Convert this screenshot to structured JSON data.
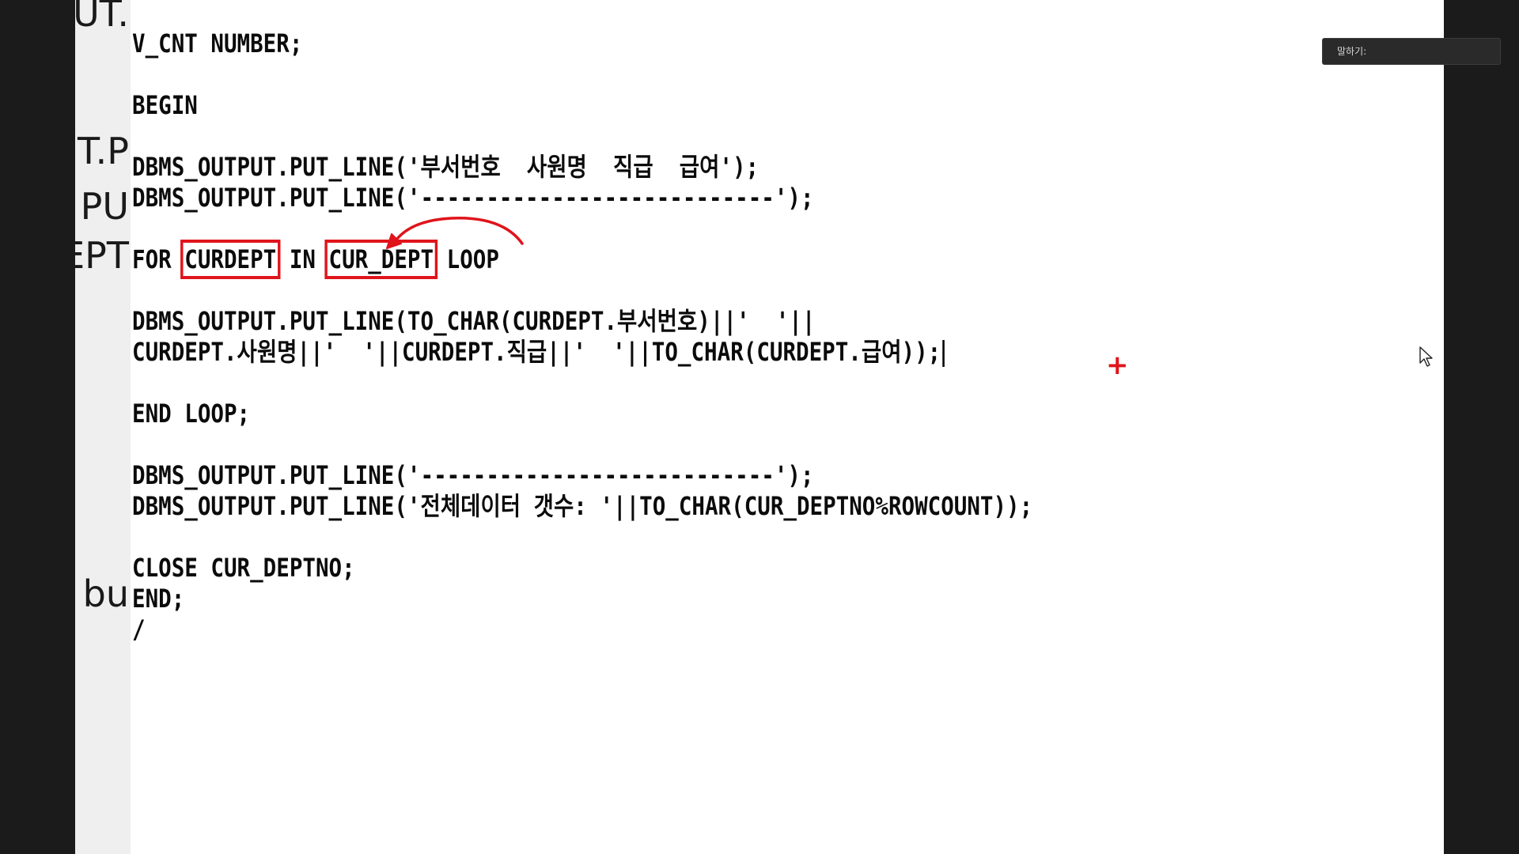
{
  "background_fragments": [
    "UT.",
    "T.P",
    "PU",
    "EPT",
    "bu"
  ],
  "code_lines": [
    "V_CNT NUMBER;",
    "",
    "BEGIN",
    "",
    "DBMS_OUTPUT.PUT_LINE('부서번호  사원명  직급  급여');",
    "DBMS_OUTPUT.PUT_LINE('---------------------------');",
    "",
    {
      "parts": [
        "FOR ",
        "CURDEPT",
        " IN ",
        "CUR_DEPT",
        " LOOP"
      ]
    },
    "",
    "DBMS_OUTPUT.PUT_LINE(TO_CHAR(CURDEPT.부서번호)||'  '||",
    "CURDEPT.사원명||'  '||CURDEPT.직급||'  '||TO_CHAR(CURDEPT.급여));",
    "",
    "END LOOP;",
    "",
    "DBMS_OUTPUT.PUT_LINE('---------------------------');",
    "DBMS_OUTPUT.PUT_LINE('전체데이터 갯수: '||TO_CHAR(CUR_DEPTNO%ROWCOUNT));",
    "",
    "CLOSE CUR_DEPTNO;",
    "END;",
    "/"
  ],
  "annotation_plus": "+",
  "speaking_panel": {
    "label": "말하기:"
  },
  "colors": {
    "annotation": "#e0141b",
    "panel_bg": "#2a2a2a"
  },
  "icons": {
    "cursor": "mouse-pointer-icon"
  }
}
